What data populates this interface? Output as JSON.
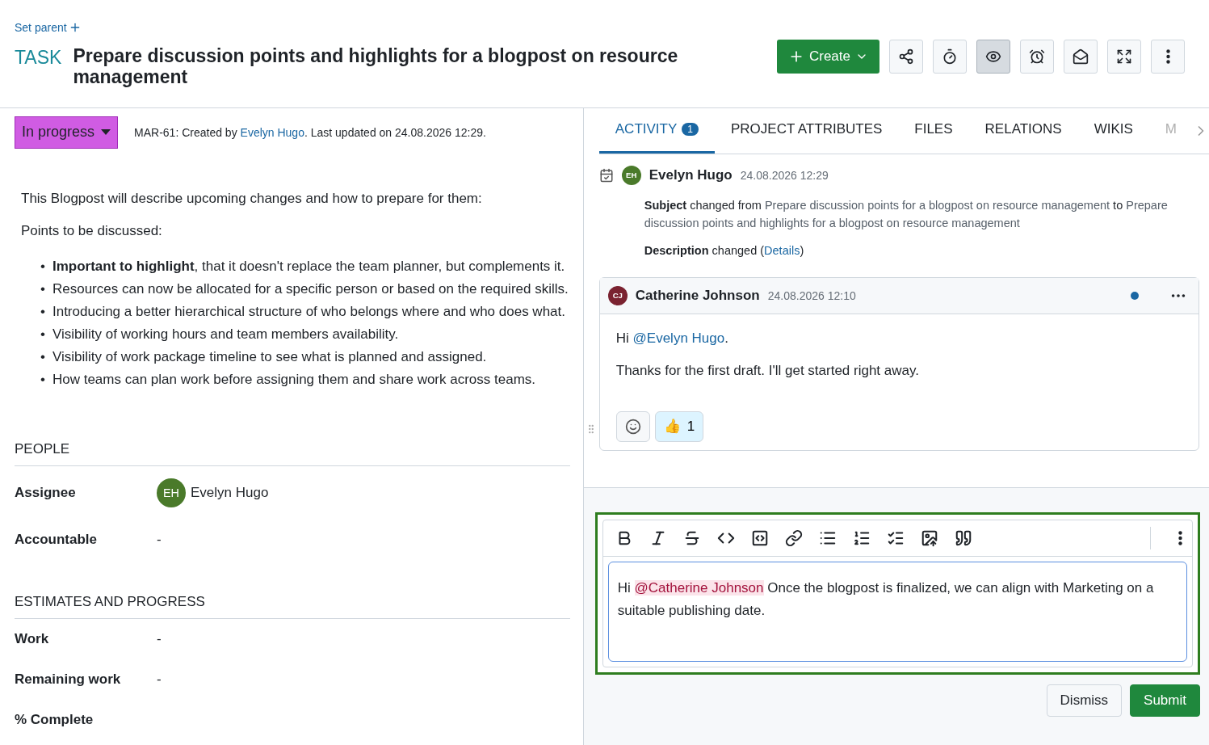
{
  "header": {
    "set_parent": "Set parent",
    "type": "TASK",
    "title": "Prepare discussion points and highlights for a blogpost on resource management",
    "create": "Create",
    "tools": [
      {
        "kind": "share",
        "selected": false
      },
      {
        "kind": "timer",
        "selected": false
      },
      {
        "kind": "watch",
        "selected": true
      },
      {
        "kind": "reminder",
        "selected": false
      },
      {
        "kind": "mail",
        "selected": false
      },
      {
        "kind": "fullscreen",
        "selected": false
      },
      {
        "kind": "more",
        "selected": false
      }
    ]
  },
  "status": {
    "label": "In progress",
    "color": "#d05ce3"
  },
  "meta": {
    "prefix": "MAR-61: Created by",
    "author": "Evelyn Hugo",
    "suffix": ". Last updated on 24.08.2026 12:29."
  },
  "description": {
    "intro": "This Blogpost will describe upcoming changes and how to prepare for them:",
    "lead": "Points to be discussed:",
    "marker": "•",
    "points": [
      "**Important to highlight**, that it doesn't replace the team planner, but complements it.",
      "Resources can now be allocated for a specific person or based on the required skills.",
      "Introducing a better hierarchical structure of who belongs where and who does what.",
      "Visibility of working hours and team members availability.",
      "Visibility of work package timeline to see what is planned and assigned.",
      "How teams can plan work before assigning them and share work across teams."
    ]
  },
  "sections": [
    {
      "title": "PEOPLE",
      "fields": [
        {
          "label": "Assignee",
          "value": "Evelyn Hugo",
          "initials": "EH",
          "color": "#4a7a2a"
        },
        {
          "label": "Accountable",
          "value": "-"
        }
      ]
    },
    {
      "title": "ESTIMATES AND PROGRESS",
      "fields": [
        {
          "label": "Work",
          "value": "-"
        },
        {
          "label": "Remaining work",
          "value": "-"
        },
        {
          "label": "% Complete"
        }
      ]
    }
  ],
  "tabs": [
    {
      "label": "ACTIVITY",
      "badge": "1",
      "selected": true
    },
    {
      "label": "PROJECT ATTRIBUTES",
      "selected": false
    },
    {
      "label": "FILES",
      "selected": false
    },
    {
      "label": "RELATIONS",
      "selected": false
    },
    {
      "label": "WIKIS",
      "selected": false
    },
    {
      "label": "M",
      "selected": false
    }
  ],
  "activity": {
    "author": "Evelyn Hugo",
    "initials": "EH",
    "color": "#4a7a2a",
    "time": "24.08.2026 12:29",
    "changes": [
      {
        "field": "Subject",
        "text": "changed from",
        "old": "Prepare discussion points for a blogpost on resource management",
        "joiner": "to",
        "new": "Prepare discussion points and highlights for a blogpost on resource management"
      },
      {
        "field": "Description",
        "text": "changed (",
        "link": "Details",
        "after": ")"
      }
    ]
  },
  "comment": {
    "author": "Catherine Johnson",
    "initials": "CJ",
    "color": "#7a2230",
    "time": "24.08.2026 12:10",
    "unread": true,
    "greeting": "Hi",
    "mention": "@Evelyn Hugo",
    "end": ".",
    "body": "Thanks for the first draft. I'll get started right away.",
    "reaction": {
      "emoji": "👍",
      "count": "1"
    }
  },
  "editor": {
    "tools": [
      {
        "kind": "bold"
      },
      {
        "kind": "italic"
      },
      {
        "kind": "strike"
      },
      {
        "kind": "code"
      },
      {
        "kind": "codeblock"
      },
      {
        "kind": "link"
      },
      {
        "kind": "bullets"
      },
      {
        "kind": "numbers"
      },
      {
        "kind": "tasks"
      },
      {
        "kind": "image"
      },
      {
        "kind": "quote"
      }
    ],
    "greeting": "Hi",
    "mention": "@Catherine Johnson",
    "text": "Once the blogpost is finalized, we can align with Marketing on a suitable publishing date.",
    "dismiss": "Dismiss",
    "submit": "Submit"
  }
}
